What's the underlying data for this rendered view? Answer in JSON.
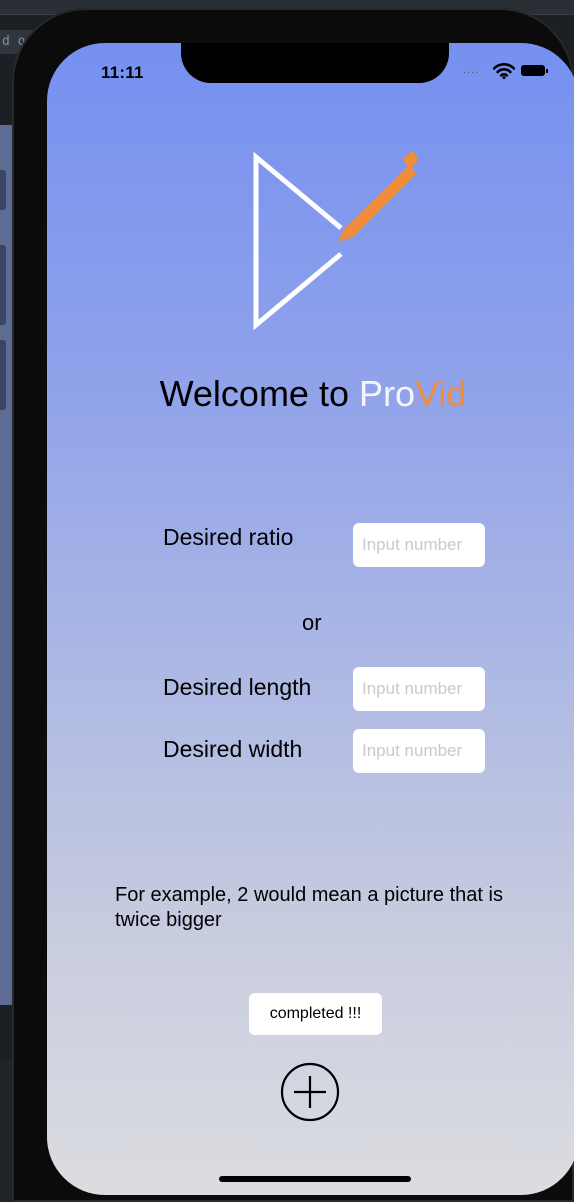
{
  "editor": {
    "tab_text": "d o"
  },
  "status_bar": {
    "time": "11:11",
    "signal": "....",
    "wifi_icon": "wifi-icon",
    "battery_icon": "battery-icon"
  },
  "logo": {
    "icon": "play-triangle-with-pencil",
    "accent_color": "#ef8d3a"
  },
  "welcome": {
    "prefix": "Welcome to ",
    "brand_part1": "Pro",
    "brand_part2": "Vid"
  },
  "form": {
    "ratio_label": "Desired ratio",
    "ratio_placeholder": "Input number",
    "or_label": "or",
    "length_label": "Desired length",
    "length_placeholder": "Input number",
    "width_label": "Desired width",
    "width_placeholder": "Input number"
  },
  "example_text": "For example, 2 would mean a picture that is twice bigger",
  "completed_label": "completed !!!",
  "add_button": {
    "icon": "plus-circle-icon"
  },
  "colors": {
    "brand_accent": "#ef8d3a",
    "brand_light": "#f6f6f8",
    "gradient_top": "#7590f0",
    "gradient_bottom": "#dcdde0"
  }
}
